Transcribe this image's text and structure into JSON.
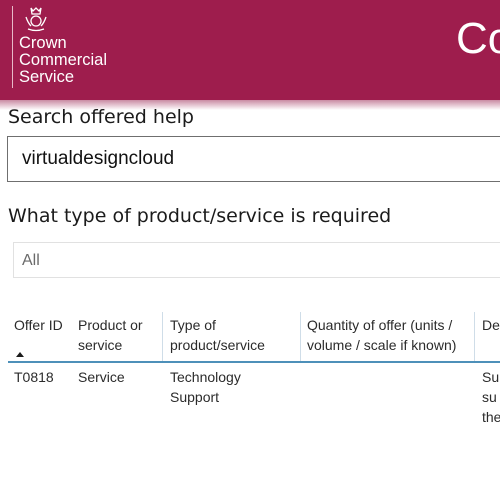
{
  "header": {
    "logo_lines": [
      "Crown",
      "Commercial",
      "Service"
    ],
    "title": "Co",
    "crest_icon": "royal-coat-of-arms"
  },
  "search": {
    "label": "Search offered help",
    "value": "virtualdesigncloud"
  },
  "product_type": {
    "label": "What type of product/service is required",
    "selected": "All"
  },
  "table": {
    "columns": [
      {
        "lines": [
          "Offer ID",
          ""
        ]
      },
      {
        "lines": [
          "Product or",
          "service"
        ]
      },
      {
        "lines": [
          "Type of",
          "product/service"
        ]
      },
      {
        "lines": [
          "Quantity of offer (units /",
          "volume / scale if known)"
        ]
      },
      {
        "lines": [
          "De",
          ""
        ]
      }
    ],
    "sorted_column": "Offer ID",
    "rows": [
      {
        "offer_id": "T0818",
        "product_or_service": "Service",
        "type_lines": [
          "Technology",
          "Support"
        ],
        "quantity": "",
        "description_lines": [
          "Su",
          "su",
          "the"
        ]
      }
    ]
  },
  "colors": {
    "header_bg": "#9e1d4d",
    "header_text": "#ffffff",
    "table_header_rule": "#4d90b9"
  }
}
